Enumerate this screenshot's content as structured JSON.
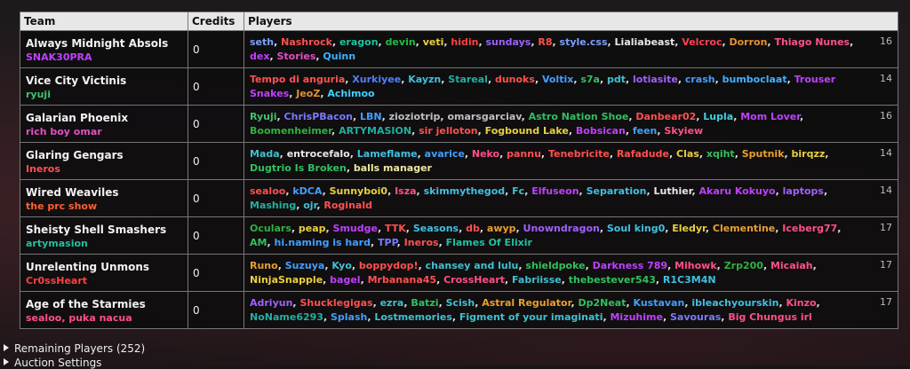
{
  "headers": {
    "team": "Team",
    "credits": "Credits",
    "players": "Players"
  },
  "teams": [
    {
      "name": "Always Midnight Absols",
      "manager": "SNAK30PRA",
      "manager_color": "#c040ff",
      "credits": "0",
      "count": "16",
      "players": [
        {
          "n": "seth",
          "c": "#7aa0ff"
        },
        {
          "n": "Nashrock",
          "c": "#ff5050"
        },
        {
          "n": "eragon",
          "c": "#20c0a0"
        },
        {
          "n": "devin",
          "c": "#22bb44"
        },
        {
          "n": "veti",
          "c": "#e8d040"
        },
        {
          "n": "hidin",
          "c": "#ff4040"
        },
        {
          "n": "sundays",
          "c": "#9a60ff"
        },
        {
          "n": "R8",
          "c": "#ff5050"
        },
        {
          "n": "style.css",
          "c": "#7aa0ff"
        },
        {
          "n": "Lialiabeast",
          "c": "#e8e8e8"
        },
        {
          "n": "Velcroc",
          "c": "#ff4050"
        },
        {
          "n": "Dorron",
          "c": "#e89030"
        },
        {
          "n": "Thiago Nunes",
          "c": "#ff5088"
        },
        {
          "n": "dex",
          "c": "#c040ff"
        },
        {
          "n": "Stories",
          "c": "#e050c0"
        },
        {
          "n": "Quinn",
          "c": "#40b0ff"
        }
      ]
    },
    {
      "name": "Vice City Victinis",
      "manager": "ryuji",
      "manager_color": "#40c070",
      "credits": "0",
      "count": "14",
      "players": [
        {
          "n": "Tempo di anguria",
          "c": "#ff5050"
        },
        {
          "n": "Xurkiyee",
          "c": "#5080ff"
        },
        {
          "n": "Kayzn",
          "c": "#40c0e0"
        },
        {
          "n": "Stareal",
          "c": "#20b0a0"
        },
        {
          "n": "dunoks",
          "c": "#ff5050"
        },
        {
          "n": "Voltix",
          "c": "#40a0ff"
        },
        {
          "n": "s7a",
          "c": "#30c060"
        },
        {
          "n": "pdt",
          "c": "#40c0d0"
        },
        {
          "n": "lotiasite",
          "c": "#a060ff"
        },
        {
          "n": "crash",
          "c": "#40a0ff"
        },
        {
          "n": "bumboclaat",
          "c": "#40b0ff"
        },
        {
          "n": "Trouser Snakes",
          "c": "#c040ff"
        },
        {
          "n": "JeoZ",
          "c": "#e09030"
        },
        {
          "n": "Achimoo",
          "c": "#40d0ff"
        }
      ]
    },
    {
      "name": "Galarian Phoenix",
      "manager": "rich boy omar",
      "manager_color": "#e050c0",
      "credits": "0",
      "count": "16",
      "players": [
        {
          "n": "Ryuji",
          "c": "#40c070"
        },
        {
          "n": "ChrisPBacon",
          "c": "#7a7aff"
        },
        {
          "n": "LBN",
          "c": "#40a0ff"
        },
        {
          "n": "zioziotrip",
          "c": "#c0c0c0"
        },
        {
          "n": "omarsgarciav",
          "c": "#c0c0c0"
        },
        {
          "n": "Astro Nation Shoe",
          "c": "#30c060"
        },
        {
          "n": "Danbear02",
          "c": "#ff5050"
        },
        {
          "n": "Lupla",
          "c": "#40d0e0"
        },
        {
          "n": "Mom Lover",
          "c": "#c040ff"
        },
        {
          "n": "Boomenheimer",
          "c": "#30b040"
        },
        {
          "n": "ARTYMASION",
          "c": "#20b0a0"
        },
        {
          "n": "sir jelloton",
          "c": "#ff5050"
        },
        {
          "n": "Fogbound Lake",
          "c": "#e8d040"
        },
        {
          "n": "Bobsican",
          "c": "#c040ff"
        },
        {
          "n": "feen",
          "c": "#40a0ff"
        },
        {
          "n": "Skyiew",
          "c": "#ff5088"
        }
      ]
    },
    {
      "name": "Glaring Gengars",
      "manager": "Ineros",
      "manager_color": "#ff5050",
      "credits": "0",
      "count": "14",
      "players": [
        {
          "n": "Mada",
          "c": "#40c0d0"
        },
        {
          "n": "entrocefalo",
          "c": "#e8e8e8"
        },
        {
          "n": "Lameflame",
          "c": "#40c0e0"
        },
        {
          "n": "avarice",
          "c": "#40a0ff"
        },
        {
          "n": "Neko",
          "c": "#ff5088"
        },
        {
          "n": "pannu",
          "c": "#ff5050"
        },
        {
          "n": "Tenebricite",
          "c": "#ff5050"
        },
        {
          "n": "Rafadude",
          "c": "#ff5050"
        },
        {
          "n": "Clas",
          "c": "#e8d040"
        },
        {
          "n": "xqiht",
          "c": "#30c060"
        },
        {
          "n": "Sputnik",
          "c": "#e8a030"
        },
        {
          "n": "birqzz",
          "c": "#e8d040"
        },
        {
          "n": "Dugtrio Is Broken",
          "c": "#30c060"
        },
        {
          "n": "balls manager",
          "c": "#e8e8a0"
        }
      ]
    },
    {
      "name": "Wired Weaviles",
      "manager": "the prc show",
      "manager_color": "#ff6030",
      "credits": "0",
      "count": "14",
      "players": [
        {
          "n": "sealoo",
          "c": "#ff5050"
        },
        {
          "n": "kDCA",
          "c": "#40a0ff"
        },
        {
          "n": "Sunnyboi0",
          "c": "#e8d040"
        },
        {
          "n": "Isza",
          "c": "#ff5088"
        },
        {
          "n": "skimmythegod",
          "c": "#40c0e0"
        },
        {
          "n": "Fc",
          "c": "#40c0d0"
        },
        {
          "n": "Elfuseon",
          "c": "#c040ff"
        },
        {
          "n": "Separation",
          "c": "#40c0e0"
        },
        {
          "n": "Luthier",
          "c": "#e8e8e8"
        },
        {
          "n": "Akaru Kokuyo",
          "c": "#c040ff"
        },
        {
          "n": "laptops",
          "c": "#a060ff"
        },
        {
          "n": "Mashing",
          "c": "#20b0a0"
        },
        {
          "n": "ojr",
          "c": "#40c0d0"
        },
        {
          "n": "Roginald",
          "c": "#ff5050"
        }
      ]
    },
    {
      "name": "Sheisty Shell Smashers",
      "manager": "artymasion",
      "manager_color": "#20c0a0",
      "credits": "0",
      "count": "17",
      "players": [
        {
          "n": "Oculars",
          "c": "#30b040"
        },
        {
          "n": "peap",
          "c": "#e8d040"
        },
        {
          "n": "Smudge",
          "c": "#c040ff"
        },
        {
          "n": "TTK",
          "c": "#ff5050"
        },
        {
          "n": "Seasons",
          "c": "#40c0e0"
        },
        {
          "n": "db",
          "c": "#ff5050"
        },
        {
          "n": "awyp",
          "c": "#e8a030"
        },
        {
          "n": "Unowndragon",
          "c": "#a060ff"
        },
        {
          "n": "Soul king0",
          "c": "#40c0e0"
        },
        {
          "n": "Eledyr",
          "c": "#e8d040"
        },
        {
          "n": "Clementine",
          "c": "#e8a030"
        },
        {
          "n": "Iceberg77",
          "c": "#ff5088"
        },
        {
          "n": "AM",
          "c": "#30c060"
        },
        {
          "n": "hi.naming is hard",
          "c": "#40a0ff"
        },
        {
          "n": "TPP",
          "c": "#7a7aff"
        },
        {
          "n": "Ineros",
          "c": "#ff5050"
        },
        {
          "n": "Flames Of Elixir",
          "c": "#20c0a0"
        }
      ]
    },
    {
      "name": "Unrelenting Unmons",
      "manager": "Cr0ssHeart",
      "manager_color": "#ff4040",
      "credits": "0",
      "count": "17",
      "players": [
        {
          "n": "Runo",
          "c": "#e8a030"
        },
        {
          "n": "Suzuya",
          "c": "#40a0ff"
        },
        {
          "n": "Kyo",
          "c": "#40c0d0"
        },
        {
          "n": "boppydop!",
          "c": "#ff5050"
        },
        {
          "n": "chansey and lulu",
          "c": "#40c0d0"
        },
        {
          "n": "shieldpoke",
          "c": "#30c060"
        },
        {
          "n": "Darkness 789",
          "c": "#c040ff"
        },
        {
          "n": "Mihowk",
          "c": "#ff5088"
        },
        {
          "n": "Zrp200",
          "c": "#30b040"
        },
        {
          "n": "Micaiah",
          "c": "#ff5088"
        },
        {
          "n": "NinjaSnapple",
          "c": "#e8d040"
        },
        {
          "n": "bagel",
          "c": "#c040ff"
        },
        {
          "n": "Mrbanana45",
          "c": "#ff5050"
        },
        {
          "n": "CrossHeart",
          "c": "#ff5088"
        },
        {
          "n": "Fabriisse",
          "c": "#40c0d0"
        },
        {
          "n": "thebestever543",
          "c": "#30c060"
        },
        {
          "n": "R1C3M4N",
          "c": "#40c0e0"
        }
      ]
    },
    {
      "name": "Age of the Starmies",
      "manager": "sealoo, puka nacua",
      "manager_color": "#ff5088",
      "credits": "0",
      "count": "17",
      "players": [
        {
          "n": "Adriyun",
          "c": "#a060ff"
        },
        {
          "n": "Shucklegigas",
          "c": "#ff5050"
        },
        {
          "n": "ezra",
          "c": "#40c0d0"
        },
        {
          "n": "Batzi",
          "c": "#30c060"
        },
        {
          "n": "Scish",
          "c": "#40c0d0"
        },
        {
          "n": "Astral Regulator",
          "c": "#e8a030"
        },
        {
          "n": "Dp2Neat",
          "c": "#30c060"
        },
        {
          "n": "Kustavan",
          "c": "#40a0ff"
        },
        {
          "n": "ibleachyourskin",
          "c": "#40c0e0"
        },
        {
          "n": "Kinzo",
          "c": "#ff5088"
        },
        {
          "n": "NoName6293",
          "c": "#20b0a0"
        },
        {
          "n": "Splash",
          "c": "#40a0ff"
        },
        {
          "n": "Lostmemories",
          "c": "#40c0d0"
        },
        {
          "n": "Figment of your imaginati",
          "c": "#40c0d0"
        },
        {
          "n": "Mizuhime",
          "c": "#c040ff"
        },
        {
          "n": "Savouras",
          "c": "#7a7aff"
        },
        {
          "n": "Big Chungus irl",
          "c": "#ff5088"
        }
      ]
    }
  ],
  "remaining_players": "Remaining Players (252)",
  "auction_settings": "Auction Settings"
}
